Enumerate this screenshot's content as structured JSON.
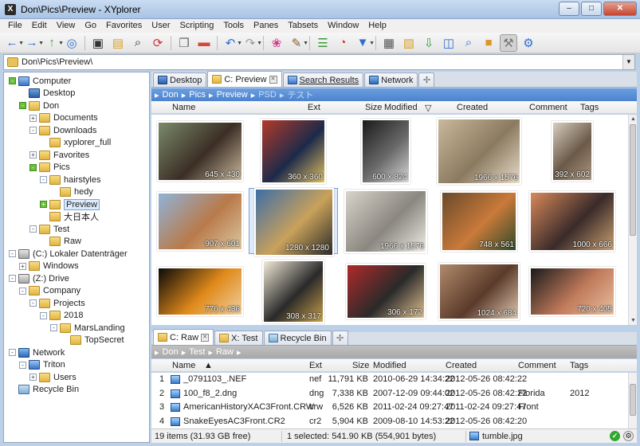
{
  "window": {
    "title": "Don\\Pics\\Preview - XYplorer",
    "app_icon_letter": "X",
    "minimize": "–",
    "maximize": "□",
    "close": "✕"
  },
  "menu": [
    "File",
    "Edit",
    "View",
    "Go",
    "Favorites",
    "User",
    "Scripting",
    "Tools",
    "Panes",
    "Tabsets",
    "Window",
    "Help"
  ],
  "toolbar": {
    "buttons": [
      {
        "name": "back-icon",
        "glyph": "←",
        "color": "#2f6fd0"
      },
      {
        "name": "forward-icon",
        "glyph": "→",
        "color": "#2f6fd0"
      },
      {
        "name": "up-icon",
        "glyph": "↑",
        "color": "#4aa43a"
      },
      {
        "name": "target-icon",
        "glyph": "◎",
        "color": "#2f6fd0"
      },
      {
        "name": "monitor-icon",
        "glyph": "▣",
        "color": "#333333"
      },
      {
        "name": "folder-add-icon",
        "glyph": "▤",
        "color": "#d8a22b"
      },
      {
        "name": "find-icon",
        "glyph": "⌕",
        "color": "#333333"
      },
      {
        "name": "goto-icon",
        "glyph": "⟳",
        "color": "#cc3333"
      },
      {
        "name": "copy-icon",
        "glyph": "❐",
        "color": "#666666"
      },
      {
        "name": "eraser-icon",
        "glyph": "▬",
        "color": "#d04a3a"
      },
      {
        "name": "undo-icon",
        "glyph": "↶",
        "color": "#2f6fd0"
      },
      {
        "name": "redo-icon",
        "glyph": "↷",
        "color": "#999999"
      },
      {
        "name": "flower-icon",
        "glyph": "❀",
        "color": "#d33d8d"
      },
      {
        "name": "brush-icon",
        "glyph": "✎",
        "color": "#8b5a2b"
      },
      {
        "name": "tree-icon",
        "glyph": "☰",
        "color": "#3a9a3a"
      },
      {
        "name": "pie-icon",
        "glyph": "◔",
        "color": "#d0392b"
      },
      {
        "name": "filter-icon",
        "glyph": "▼",
        "color": "#2f6fd0"
      },
      {
        "name": "grid-icon",
        "glyph": "▦",
        "color": "#555555"
      },
      {
        "name": "layout-icon",
        "glyph": "▧",
        "color": "#d8a22b"
      },
      {
        "name": "pane-down-icon",
        "glyph": "⇩",
        "color": "#3a9a3a"
      },
      {
        "name": "split-icon",
        "glyph": "◫",
        "color": "#2f6fd0"
      },
      {
        "name": "search-icon",
        "glyph": "⌕",
        "color": "#2f6fd0"
      },
      {
        "name": "box-icon",
        "glyph": "■",
        "color": "#e0962a"
      },
      {
        "name": "tools-icon",
        "glyph": "⚒",
        "color": "#777777"
      },
      {
        "name": "settings-icon",
        "glyph": "⚙",
        "color": "#2f6fd0"
      }
    ]
  },
  "address": {
    "path": "Don\\Pics\\Preview\\",
    "dropdown": "▼"
  },
  "tree": [
    {
      "label": "Computer",
      "ico": "comp",
      "indent": 0,
      "exp": "-",
      "green": true
    },
    {
      "label": "Desktop",
      "ico": "desk",
      "indent": 1,
      "exp": ""
    },
    {
      "label": "Don",
      "ico": "folder",
      "indent": 1,
      "exp": "-",
      "green": true
    },
    {
      "label": "Documents",
      "ico": "folder",
      "indent": 2,
      "exp": "+"
    },
    {
      "label": "Downloads",
      "ico": "folder",
      "indent": 2,
      "exp": "-"
    },
    {
      "label": "xyplorer_full",
      "ico": "folder",
      "indent": 3,
      "exp": ""
    },
    {
      "label": "Favorites",
      "ico": "folder",
      "indent": 2,
      "exp": "+"
    },
    {
      "label": "Pics",
      "ico": "folder",
      "indent": 2,
      "exp": "-",
      "green": true
    },
    {
      "label": "hairstyles",
      "ico": "folder",
      "indent": 3,
      "exp": "-"
    },
    {
      "label": "hedy",
      "ico": "folder",
      "indent": 4,
      "exp": ""
    },
    {
      "label": "Preview",
      "ico": "folder",
      "indent": 3,
      "exp": "+",
      "green": true,
      "selected": true
    },
    {
      "label": "大日本人",
      "ico": "folder",
      "indent": 3,
      "exp": ""
    },
    {
      "label": "Test",
      "ico": "folder",
      "indent": 2,
      "exp": "-"
    },
    {
      "label": "Raw",
      "ico": "folder",
      "indent": 3,
      "exp": ""
    },
    {
      "label": "(C:) Lokaler Datenträger",
      "ico": "drive",
      "indent": 0,
      "exp": "-"
    },
    {
      "label": "Windows",
      "ico": "folder",
      "indent": 1,
      "exp": "+"
    },
    {
      "label": "(Z:) Drive",
      "ico": "drive",
      "indent": 0,
      "exp": "-"
    },
    {
      "label": "Company",
      "ico": "folder",
      "indent": 1,
      "exp": "-"
    },
    {
      "label": "Projects",
      "ico": "folder",
      "indent": 2,
      "exp": "-"
    },
    {
      "label": "2018",
      "ico": "folder",
      "indent": 3,
      "exp": "-"
    },
    {
      "label": "MarsLanding",
      "ico": "folder",
      "indent": 4,
      "exp": "-"
    },
    {
      "label": "TopSecret",
      "ico": "folder",
      "indent": 5,
      "exp": ""
    },
    {
      "label": "Network",
      "ico": "net",
      "indent": 0,
      "exp": "-"
    },
    {
      "label": "Triton",
      "ico": "comp",
      "indent": 1,
      "exp": "-"
    },
    {
      "label": "Users",
      "ico": "folder",
      "indent": 2,
      "exp": "+"
    },
    {
      "label": "Recycle Bin",
      "ico": "bin",
      "indent": 0,
      "exp": ""
    }
  ],
  "upper_tabs": [
    {
      "label": "Desktop",
      "ico": "desk"
    },
    {
      "label": "C: Preview",
      "ico": "folder",
      "active": true,
      "closable": true
    },
    {
      "label": "Search Results",
      "ico": "search",
      "underline": true
    },
    {
      "label": "Network",
      "ico": "net"
    }
  ],
  "upper_crumbs": {
    "items": [
      "Don",
      "Pics",
      "Preview"
    ],
    "faded": [
      "PSD",
      "テスト"
    ],
    "separator": "▸"
  },
  "columns": {
    "name": "Name",
    "ext": "Ext",
    "size": "Size",
    "modified": "Modified",
    "sort_marker": "▽",
    "created": "Created",
    "comment": "Comment",
    "tags": "Tags"
  },
  "thumbnails": [
    {
      "dims": "645 x 430",
      "colors": [
        "#7a8a6a",
        "#3b2e25",
        "#c8b79a"
      ]
    },
    {
      "dims": "360 x 360",
      "colors": [
        "#b33a2a",
        "#1d2a4a",
        "#e0c060"
      ]
    },
    {
      "dims": "600 x 824",
      "colors": [
        "#1a1a1a",
        "#6a6a6a",
        "#d8d8d8"
      ]
    },
    {
      "dims": "1966 x 1576",
      "colors": [
        "#c9b89a",
        "#8a7a60",
        "#e8dcc8"
      ]
    },
    {
      "dims": "392 x 602",
      "colors": [
        "#d7cdbf",
        "#6b5a48",
        "#a99680"
      ]
    },
    {
      "dims": "907 x 601",
      "colors": [
        "#8fb3d8",
        "#b97a4a",
        "#d9c7a0"
      ]
    },
    {
      "dims": "1280 x 1280",
      "colors": [
        "#3d6ea6",
        "#c9a15a",
        "#2b2b2b"
      ],
      "selected": true
    },
    {
      "dims": "1966 x 1576",
      "colors": [
        "#d8d4cb",
        "#8a8780",
        "#f0ede6"
      ]
    },
    {
      "dims": "748 x 561",
      "colors": [
        "#6a4a2a",
        "#c97a3a",
        "#2f4a2a"
      ]
    },
    {
      "dims": "1000 x 666",
      "colors": [
        "#d88a5a",
        "#3a2a2a",
        "#c9a070"
      ]
    },
    {
      "dims": "776 x 436",
      "colors": [
        "#0a0a0a",
        "#e08a1a",
        "#f0d0a0"
      ]
    },
    {
      "dims": "308 x 317",
      "colors": [
        "#f2ead8",
        "#2a2a2a",
        "#c9a04a"
      ]
    },
    {
      "dims": "306 x 172",
      "colors": [
        "#b02a2a",
        "#2a2a2a",
        "#e0c090"
      ]
    },
    {
      "dims": "1024 x 684",
      "colors": [
        "#b08a6a",
        "#5a3a2a",
        "#e0c8b0"
      ]
    },
    {
      "dims": "720 x 405",
      "colors": [
        "#1a1a1a",
        "#c07a5a",
        "#e8c0a0"
      ]
    }
  ],
  "lower_tabs": [
    {
      "label": "C: Raw",
      "ico": "folder",
      "active": true,
      "closable": true
    },
    {
      "label": "X: Test",
      "ico": "folder"
    },
    {
      "label": "Recycle Bin",
      "ico": "bin"
    }
  ],
  "lower_crumbs": {
    "items": [
      "Don",
      "Test",
      "Raw"
    ],
    "separator": "▸"
  },
  "lower_columns": {
    "name": "Name",
    "sort_marker": "▲",
    "ext": "Ext",
    "size": "Size",
    "modified": "Modified",
    "created": "Created",
    "comment": "Comment",
    "tags": "Tags"
  },
  "files": [
    {
      "num": "1",
      "name": "_0791103_.NEF",
      "ext": "nef",
      "size": "11,791 KB",
      "modified": "2010-06-29 14:34:22",
      "created": "2012-05-26 08:42:22",
      "comment": "",
      "tags": ""
    },
    {
      "num": "2",
      "name": "100_f8_2.dng",
      "ext": "dng",
      "size": "7,338 KB",
      "modified": "2007-12-09 09:44:02",
      "created": "2012-05-26 08:42:22",
      "comment": "Florida",
      "tags": "2012"
    },
    {
      "num": "3",
      "name": "AmericanHistoryXAC3Front.CRW",
      "ext": "crw",
      "size": "6,526 KB",
      "modified": "2011-02-24 09:27:47",
      "created": "2011-02-24 09:27:47",
      "comment": "Front",
      "tags": ""
    },
    {
      "num": "4",
      "name": "SnakeEyesAC3Front.CR2",
      "ext": "cr2",
      "size": "5,904 KB",
      "modified": "2009-08-10 14:53:22",
      "created": "2012-05-26 08:42:20",
      "comment": "",
      "tags": ""
    }
  ],
  "status": {
    "items": "19 items (31.93 GB free)",
    "selected": "1 selected: 541.90 KB (554,901 bytes)",
    "file": "tumble.jpg",
    "ok": "✓",
    "cfg": "⚙"
  }
}
